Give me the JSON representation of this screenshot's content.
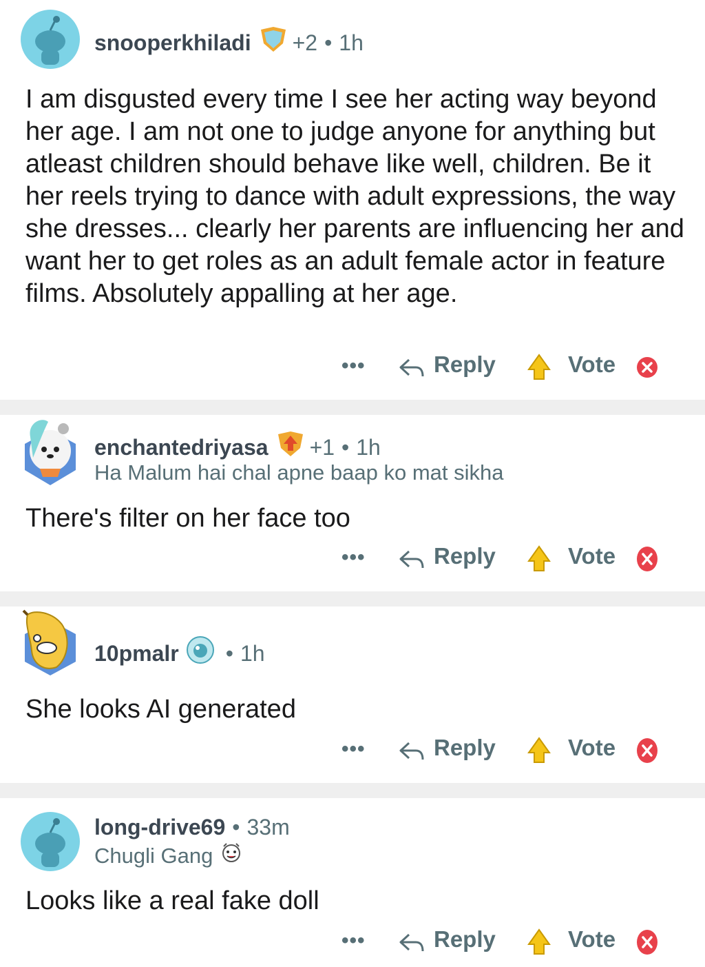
{
  "comments": [
    {
      "username": "snooperkhiladi",
      "score": "+2",
      "time": "1h",
      "text": "I am disgusted every time I see her acting way beyond her age. I am not one to judge anyone for anything but atleast children should behave like well, children. Be it her reels trying to dance with adult expressions, the way she dresses... clearly her parents are influencing her and want her to get roles as an adult female actor in feature films. Absolutely appalling at her age.",
      "avatar": "default-snoo-avatar"
    },
    {
      "username": "enchantedriyasa",
      "score": "+1",
      "time": "1h",
      "flair": "Ha Malum hai chal apne baap ko mat sikha",
      "text": "There's filter on her face too",
      "avatar": "cartoon-dog-avatar"
    },
    {
      "username": "10pmalr",
      "time": "1h",
      "text": "She looks AI generated",
      "avatar": "banana-avatar"
    },
    {
      "username": "long-drive69",
      "time": "33m",
      "flair": "Chugli Gang",
      "text": "Looks like a real fake doll",
      "avatar": "default-snoo-avatar"
    }
  ],
  "actions": {
    "more": "•••",
    "reply": "Reply",
    "vote": "Vote"
  },
  "separator_dot": "•",
  "colors": {
    "avatar_bg": "#7dd3e6",
    "separator": "#efefef",
    "vote_gold": "#f5c518",
    "downvote_red": "#e8414b"
  }
}
